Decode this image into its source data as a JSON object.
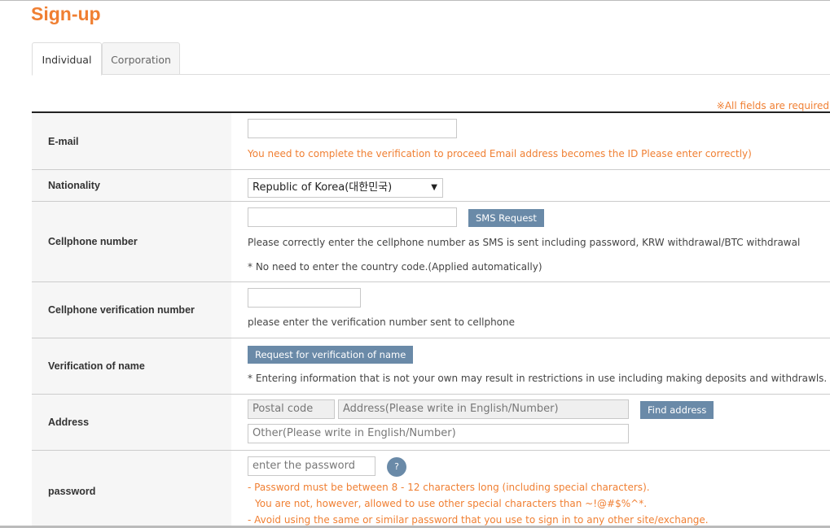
{
  "page": {
    "title": "Sign-up"
  },
  "tabs": [
    {
      "label": "Individual",
      "active": true
    },
    {
      "label": "Corporation",
      "active": false
    }
  ],
  "required_note": "※All fields are required",
  "form": {
    "email": {
      "label": "E-mail",
      "value": "",
      "note": "You need to complete the verification to proceed Email address becomes the ID Please enter correctly)"
    },
    "nationality": {
      "label": "Nationality",
      "selected": "Republic of Korea(대한민국)"
    },
    "cellphone": {
      "label": "Cellphone number",
      "value": "",
      "button": "SMS Request",
      "note1": "Please correctly enter the cellphone number as SMS is sent including password, KRW withdrawal/BTC withdrawal",
      "note2": "* No need to enter the country code.(Applied automatically)"
    },
    "verification_number": {
      "label": "Cellphone verification number",
      "value": "",
      "note": "please enter the verification number sent to cellphone"
    },
    "name_verification": {
      "label": "Verification of name",
      "button": "Request for verification of name",
      "note": "* Entering information that is not your own may result in restrictions in use including making deposits and withdrawls."
    },
    "address": {
      "label": "Address",
      "postal_placeholder": "Postal code",
      "address_placeholder": "Address(Please write in English/Number)",
      "button": "Find address",
      "other_placeholder": "Other(Please write in English/Number)"
    },
    "password": {
      "label": "password",
      "placeholder": "enter the password",
      "help": "?",
      "rule1": "- Password must be between 8 - 12 characters long (including special characters).",
      "rule2": "You are not, however, allowed to use other special characters than ~!@#$%^*.",
      "rule3": "- Avoid using the same or similar password that you use to sign in to any other site/exchange."
    }
  },
  "colors": {
    "accent": "#f07f32",
    "button": "#6a8aa8",
    "label_bg": "#f6f6f6"
  }
}
